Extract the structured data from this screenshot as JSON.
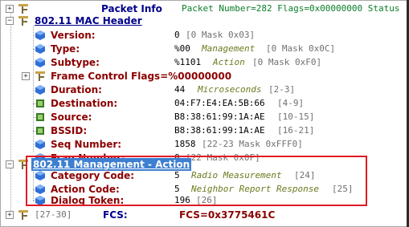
{
  "top": {
    "packet_info_label": "Packet Info",
    "packet_line": "Packet Number=282 Flags=0x00000000 Status"
  },
  "mac_header": {
    "title": "802.11 MAC Header",
    "fields": [
      {
        "label": "Version:",
        "value": "0",
        "info": "[0 Mask 0x03]"
      },
      {
        "label": "Type:",
        "value": "%00",
        "note": "Management",
        "info": "[0 Mask 0x0C]"
      },
      {
        "label": "Subtype:",
        "value": "%1101",
        "note": "Action",
        "info": "[0 Mask 0xF0]"
      },
      {
        "label": "Frame Control Flags=%00000000"
      },
      {
        "label": "Duration:",
        "value": "44",
        "note": "Microseconds",
        "info": "[2-3]"
      },
      {
        "label": "Destination:",
        "value": "04:F7:E4:EA:5B:66",
        "info": "[4-9]"
      },
      {
        "label": "Source:",
        "value": "B8:38:61:99:1A:AE",
        "info": "[10-15]"
      },
      {
        "label": "BSSID:",
        "value": "B8:38:61:99:1A:AE",
        "info": "[16-21]"
      },
      {
        "label": "Seq Number:",
        "value": "1858",
        "info": "[22-23 Mask 0xFFF0]"
      },
      {
        "label": "Frag Number:",
        "value": "0",
        "info": "[22 Mask 0x0F]"
      }
    ]
  },
  "action": {
    "title": "802.11 Management - Action",
    "fields": [
      {
        "label": "Category Code:",
        "value": "5",
        "note": "Radio Measurement",
        "info": "[24]"
      },
      {
        "label": "Action Code:",
        "value": "5",
        "note": "Neighbor Report Response",
        "info": "[25]"
      },
      {
        "label": "Dialog Token:",
        "value": "196",
        "info": "[26]"
      }
    ]
  },
  "fcs": {
    "range": "[27-30]",
    "label": "FCS:",
    "value": "FCS=0x3775461C"
  },
  "colors": {
    "label": "#8b0000",
    "header": "#00008b",
    "selection": "#3d7fd0",
    "highlight_box": "#e01b24",
    "note": "#6b7a1e"
  },
  "icons": {
    "section": "protocol-branch-icon",
    "field": "blue-cube-icon",
    "address": "green-chip-icon"
  }
}
